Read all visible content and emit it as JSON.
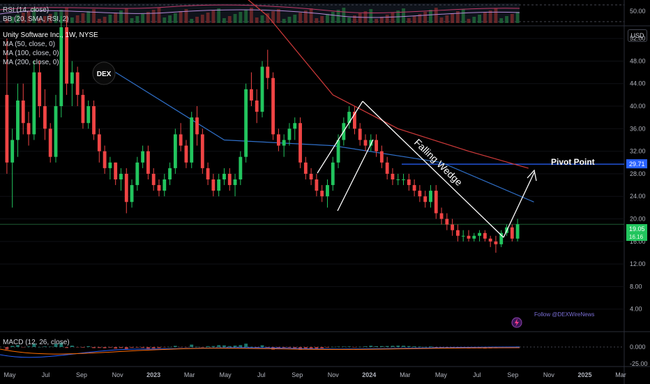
{
  "symbol": {
    "title": "Unity Software Inc., 1W, NYSE"
  },
  "rsi_pane": {
    "labels": [
      "RSI (14, close)",
      "BB (20, SMA, RSI, 2)"
    ],
    "axis_tick": "50.00"
  },
  "main_legend": [
    "MA (50, close, 0)",
    "MA (100, close, 0)",
    "MA (200, close, 0)"
  ],
  "macd_pane": {
    "label": "MACD (12, 26, close)",
    "ticks": [
      "0.000",
      "-25.00"
    ]
  },
  "currency_badge": "USD",
  "logo_text": "DEX",
  "follow_text": "Follow @DEXWireNews",
  "colors": {
    "up": "#22c55e",
    "down": "#ef4444",
    "ma50": "#2f6fc8",
    "ma100": "#d33b3b",
    "pivot": "#2962ff",
    "wedge": "#ffffff",
    "current_price": "#22c55e",
    "background": "#000000"
  },
  "chart_data": {
    "type": "candlestick",
    "title": "Unity Software Inc., 1W, NYSE",
    "y_axis_ticks": [
      "52.00",
      "48.00",
      "44.00",
      "40.00",
      "36.00",
      "32.00",
      "28.00",
      "24.00",
      "20.00",
      "16.00",
      "12.00",
      "8.00",
      "4.00"
    ],
    "ylim": [
      0,
      54
    ],
    "x_axis_ticks": [
      "May",
      "Jul",
      "Sep",
      "Nov",
      "2023",
      "Mar",
      "May",
      "Jul",
      "Sep",
      "Nov",
      "2024",
      "Mar",
      "May",
      "Jul",
      "Sep",
      "Nov",
      "2025",
      "Mar"
    ],
    "price_labels": {
      "pivot": "29.71",
      "last": "19.05",
      "last_sub": "16.16"
    },
    "annotations": {
      "pattern": "Falling Wedge",
      "target": "Pivot Point"
    },
    "pivot_level": 29.71,
    "last_close": 19.05,
    "candles": [
      [
        42,
        52,
        28,
        30
      ],
      [
        30,
        36,
        22,
        34
      ],
      [
        34,
        44,
        31,
        41
      ],
      [
        41,
        44,
        35,
        37
      ],
      [
        37,
        39,
        33,
        35
      ],
      [
        35,
        48,
        34,
        46
      ],
      [
        46,
        48,
        38,
        40
      ],
      [
        40,
        43,
        34,
        36
      ],
      [
        36,
        37,
        30,
        31
      ],
      [
        31,
        42,
        30,
        40
      ],
      [
        40,
        56,
        38,
        54
      ],
      [
        54,
        56,
        42,
        44
      ],
      [
        44,
        48,
        40,
        46
      ],
      [
        46,
        47,
        40,
        42
      ],
      [
        42,
        43,
        36,
        37
      ],
      [
        37,
        41,
        36,
        40
      ],
      [
        40,
        41,
        34,
        35
      ],
      [
        35,
        36,
        30,
        32
      ],
      [
        32,
        33,
        28,
        29
      ],
      [
        29,
        31,
        27,
        30
      ],
      [
        30,
        30,
        26,
        27
      ],
      [
        27,
        29,
        25,
        28
      ],
      [
        28,
        29,
        21,
        23
      ],
      [
        23,
        27,
        22,
        26
      ],
      [
        26,
        31,
        25,
        30
      ],
      [
        30,
        33,
        29,
        32
      ],
      [
        32,
        33,
        27,
        28
      ],
      [
        28,
        29,
        25,
        26
      ],
      [
        26,
        27,
        24,
        25
      ],
      [
        25,
        28,
        24,
        27
      ],
      [
        27,
        30,
        26,
        29
      ],
      [
        29,
        36,
        28,
        35
      ],
      [
        35,
        37,
        32,
        33
      ],
      [
        33,
        34,
        29,
        30
      ],
      [
        30,
        39,
        29,
        38
      ],
      [
        38,
        40,
        33,
        35
      ],
      [
        35,
        36,
        28,
        29
      ],
      [
        29,
        30,
        26,
        27
      ],
      [
        27,
        28,
        24,
        25
      ],
      [
        25,
        28,
        24,
        27
      ],
      [
        27,
        29,
        26,
        28
      ],
      [
        28,
        29,
        25,
        26
      ],
      [
        26,
        28,
        24,
        27
      ],
      [
        27,
        32,
        26,
        31
      ],
      [
        31,
        44,
        30,
        43
      ],
      [
        43,
        46,
        40,
        41
      ],
      [
        41,
        43,
        37,
        39
      ],
      [
        39,
        48,
        38,
        47
      ],
      [
        47,
        50,
        43,
        45
      ],
      [
        45,
        46,
        34,
        35
      ],
      [
        35,
        36,
        32,
        33
      ],
      [
        33,
        35,
        31,
        34
      ],
      [
        34,
        37,
        33,
        36
      ],
      [
        36,
        38,
        34,
        37
      ],
      [
        37,
        38,
        29,
        30
      ],
      [
        30,
        31,
        27,
        28
      ],
      [
        28,
        29,
        26,
        27
      ],
      [
        27,
        28,
        24,
        25
      ],
      [
        25,
        26,
        23,
        24
      ],
      [
        24,
        27,
        22,
        26
      ],
      [
        26,
        31,
        25,
        30
      ],
      [
        30,
        35,
        29,
        34
      ],
      [
        34,
        38,
        33,
        37
      ],
      [
        37,
        40,
        36,
        39
      ],
      [
        39,
        40,
        35,
        36
      ],
      [
        36,
        37,
        33,
        34
      ],
      [
        34,
        35,
        32,
        33
      ],
      [
        33,
        35,
        32,
        34
      ],
      [
        34,
        35,
        31,
        32
      ],
      [
        32,
        33,
        29,
        30
      ],
      [
        30,
        31,
        27,
        28
      ],
      [
        28,
        29,
        26,
        27
      ],
      [
        27,
        28,
        26,
        27
      ],
      [
        27,
        28,
        26,
        27
      ],
      [
        27,
        28,
        25,
        26
      ],
      [
        26,
        27,
        24,
        25
      ],
      [
        25,
        26,
        23,
        24
      ],
      [
        24,
        25,
        22,
        23
      ],
      [
        23,
        26,
        22,
        25
      ],
      [
        25,
        26,
        20,
        21
      ],
      [
        21,
        22,
        19,
        20
      ],
      [
        20,
        21,
        18,
        19
      ],
      [
        19,
        20,
        17,
        18
      ],
      [
        18,
        19,
        16,
        17
      ],
      [
        17,
        18,
        16,
        17
      ],
      [
        17,
        18,
        16,
        16.5
      ],
      [
        16.5,
        17.5,
        16,
        17
      ],
      [
        17,
        18,
        16,
        17.5
      ],
      [
        17.5,
        18,
        16,
        16.5
      ],
      [
        16.5,
        17,
        15,
        16
      ],
      [
        16,
        17,
        14,
        15.5
      ],
      [
        15.5,
        18,
        15,
        17.5
      ],
      [
        17.5,
        19,
        17,
        18.5
      ],
      [
        18.5,
        19,
        16,
        16.5
      ],
      [
        16.5,
        20,
        16,
        19.05
      ]
    ],
    "series": [
      {
        "name": "MA (50, close, 0)",
        "x": [
          20,
          40,
          60,
          80,
          97
        ],
        "values": [
          46,
          34,
          33,
          30,
          23
        ]
      },
      {
        "name": "MA (100, close, 0)",
        "x": [
          43,
          48,
          60,
          72,
          85,
          96
        ],
        "values": [
          60,
          56,
          42,
          36,
          32,
          29
        ]
      }
    ]
  }
}
